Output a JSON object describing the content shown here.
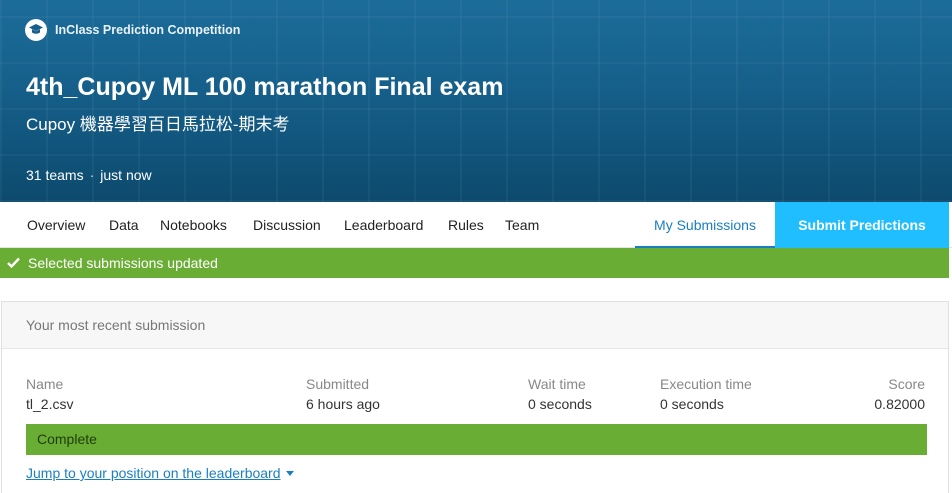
{
  "header": {
    "badge": "InClass Prediction Competition",
    "title": "4th_Cupoy ML 100 marathon Final exam",
    "subtitle": "Cupoy 機器學習百日馬拉松-期末考",
    "teams": "31 teams",
    "separator": "·",
    "updated": "just now"
  },
  "nav": {
    "items": [
      "Overview",
      "Data",
      "Notebooks",
      "Discussion",
      "Leaderboard",
      "Rules",
      "Team"
    ],
    "my_submissions": "My Submissions",
    "submit_predictions": "Submit Predictions"
  },
  "banner": {
    "message": "Selected submissions updated"
  },
  "submission": {
    "heading": "Your most recent submission",
    "columns": {
      "name": "Name",
      "submitted": "Submitted",
      "wait_time": "Wait time",
      "execution_time": "Execution time",
      "score": "Score"
    },
    "values": {
      "name": "tl_2.csv",
      "submitted": "6 hours ago",
      "wait_time": "0 seconds",
      "execution_time": "0 seconds",
      "score": "0.82000"
    },
    "status": "Complete",
    "jump_link": "Jump to your position on the leaderboard"
  },
  "colors": {
    "header_blue": "#155f8a",
    "accent_blue": "#20beff",
    "link_blue": "#1a7fc1",
    "success_green": "#6aad35"
  }
}
